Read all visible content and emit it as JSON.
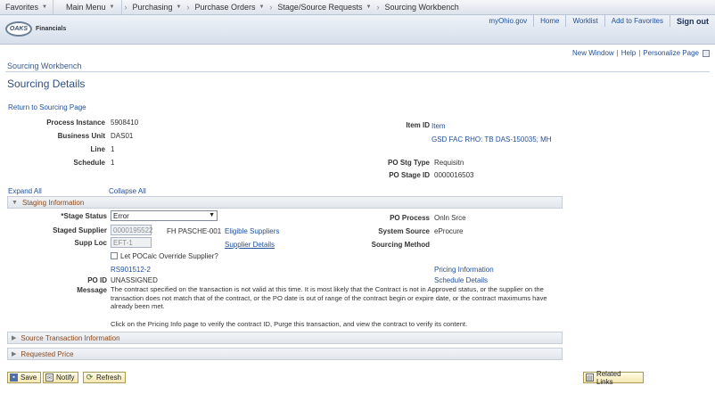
{
  "topnav": {
    "favorites": "Favorites",
    "main_menu": "Main Menu",
    "crumbs": [
      "Purchasing",
      "Purchase Orders",
      "Stage/Source Requests",
      "Sourcing Workbench"
    ]
  },
  "header": {
    "logo_mark": "OAKS",
    "logo_text": "Financials",
    "links": [
      "myOhio.gov",
      "Home",
      "Worklist",
      "Add to Favorites"
    ],
    "signout": "Sign out"
  },
  "pagelinks": [
    "New Window",
    "Help",
    "Personalize Page"
  ],
  "component_title": "Sourcing Workbench",
  "page_title": "Sourcing Details",
  "return_link": "Return to Sourcing Page",
  "fields": {
    "process_instance_label": "Process Instance",
    "process_instance": "5908410",
    "business_unit_label": "Business Unit",
    "business_unit": "DAS01",
    "line_label": "Line",
    "line": "1",
    "schedule_label": "Schedule",
    "schedule": "1",
    "item_id_label": "Item ID",
    "item_id_link": "Item",
    "item_desc": "GSD FAC RHO: TB DAS-150035; MH",
    "po_stg_type_label": "PO Stg Type",
    "po_stg_type": "Requisitn",
    "po_stage_id_label": "PO Stage ID",
    "po_stage_id": "0000016503"
  },
  "expand_all": "Expand All",
  "collapse_all": "Collapse All",
  "staging": {
    "title": "Staging Information",
    "stage_status_label": "*Stage Status",
    "stage_status": "Error",
    "staged_supplier_label": "Staged Supplier",
    "staged_supplier": "0000195522",
    "supplier_name": "FH PASCHE-001",
    "eligible_suppliers": "Eligible Suppliers",
    "supp_loc_label": "Supp Loc",
    "supp_loc": "EFT-1",
    "supplier_details": "Supplier Details",
    "po_process_label": "PO Process",
    "po_process": "Onln Srce",
    "system_source_label": "System Source",
    "system_source": "eProcure",
    "sourcing_method_label": "Sourcing Method",
    "override_label": "Let POCalc Override Supplier?",
    "contract_link": "RS901512-2",
    "pricing_info": "Pricing Information",
    "po_id_label": "PO ID",
    "po_id": "UNASSIGNED",
    "schedule_details": "Schedule Details",
    "message_label": "Message",
    "message_1": "The contract specified on the transaction is not valid at this time. It is most likely that the Contract is not in Approved status, or the supplier on the transaction does not match that of the contract, or the PO date is out of range of the contract begin or expire date, or the contract maximums have already been met.",
    "message_2": "Click on the Pricing Info page to verify the contract ID, Purge this transaction, and view the contract to verify its content."
  },
  "sections": {
    "source_txn": "Source Transaction Information",
    "requested_price": "Requested Price"
  },
  "buttons": {
    "save": "Save",
    "notify": "Notify",
    "refresh": "Refresh",
    "related_links": "Related Links"
  }
}
